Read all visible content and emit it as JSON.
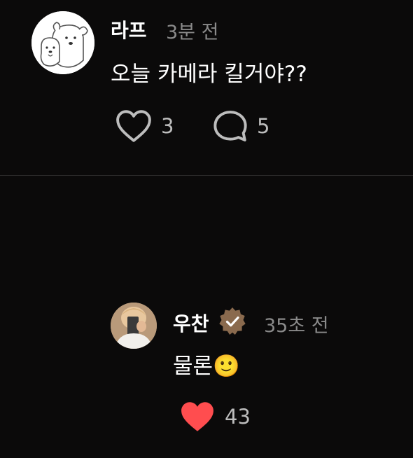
{
  "post": {
    "author": "라프",
    "time": "3분 전",
    "text": "오늘 카메라 킬거야??",
    "like_count": "3",
    "comment_count": "5"
  },
  "reply": {
    "author": "우찬",
    "verified": true,
    "time": "35초 전",
    "text": "물론🙂",
    "like_count": "43",
    "liked": true
  },
  "colors": {
    "background": "#0b0a0a",
    "heart_liked": "#ff4d4f",
    "verified_badge": "#8a6a4e",
    "muted_text": "#8a8a8a"
  },
  "icons": {
    "like": "heart-outline-icon",
    "comment": "speech-bubble-icon",
    "liked": "heart-filled-icon",
    "verified": "verified-badge-icon"
  }
}
